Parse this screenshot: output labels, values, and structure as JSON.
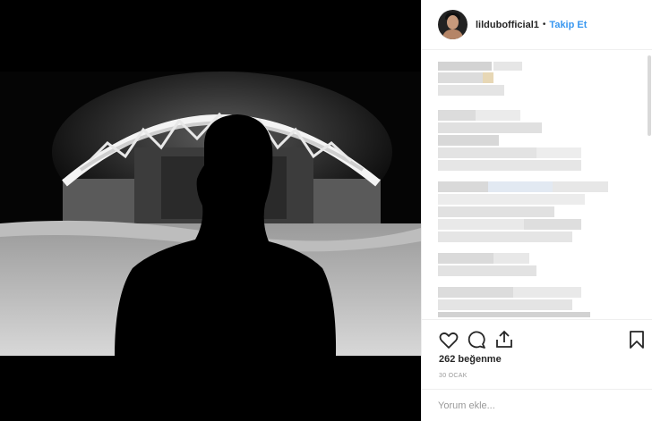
{
  "post": {
    "username": "lildubofficial1",
    "separator": "•",
    "follow_label": "Takip Et",
    "likes_text": "262 beğenme",
    "date_text": "30 OCAK",
    "comment_placeholder": "Yorum ekle..."
  },
  "icons": {
    "like": "heart-icon",
    "comment": "comment-icon",
    "share": "share-icon",
    "save": "bookmark-icon"
  },
  "colors": {
    "link": "#3897f0",
    "text": "#262626",
    "muted": "#999999",
    "border": "#efefef"
  }
}
